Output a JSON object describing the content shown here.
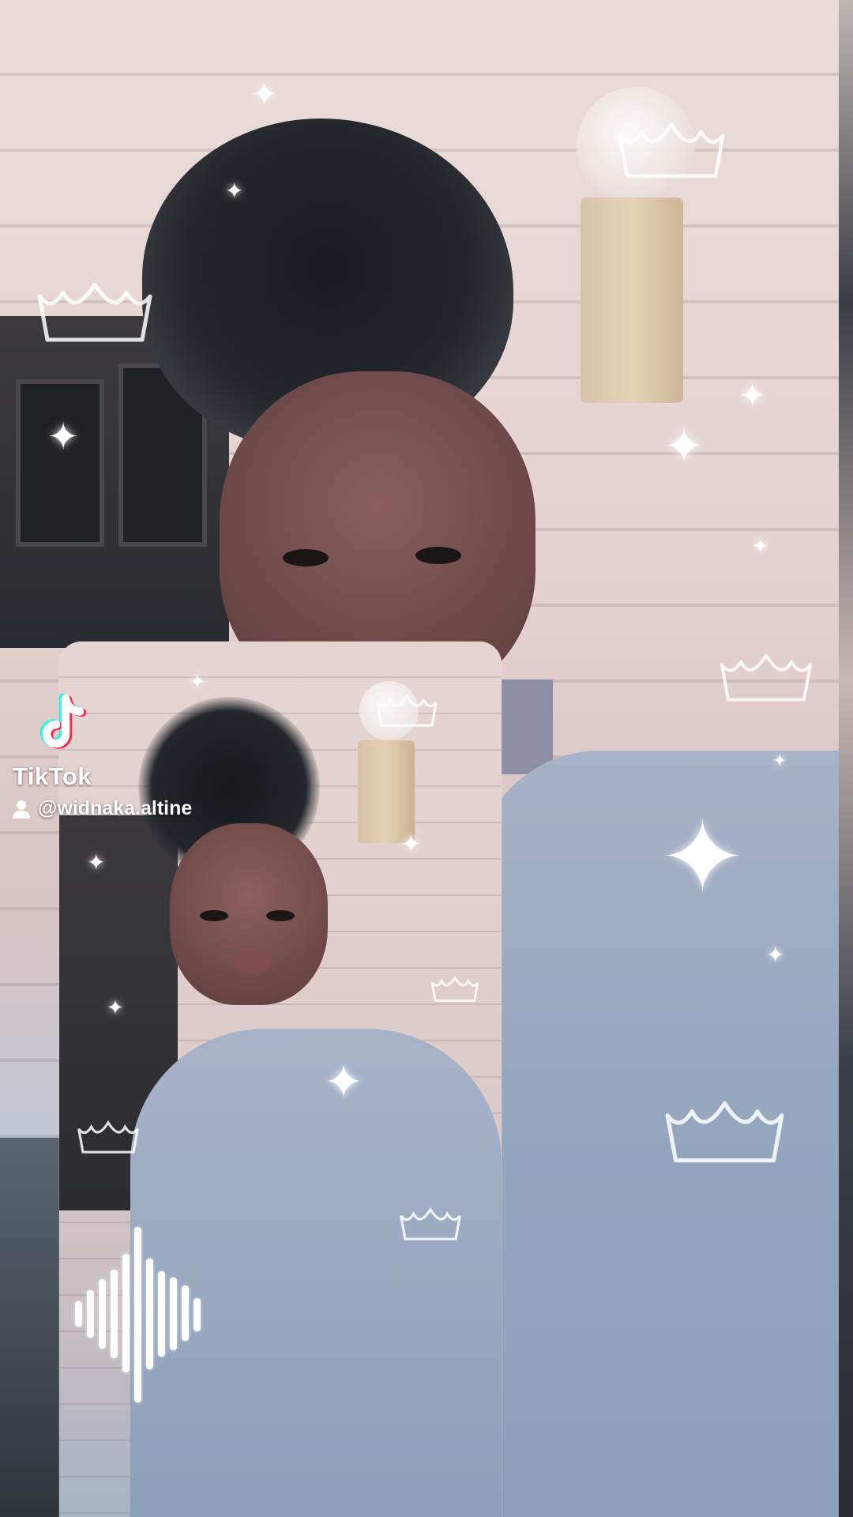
{
  "watermark": {
    "brand": "TikTok",
    "username": "@widnaka.altine",
    "logo_icon": "tiktok-logo-icon",
    "user_icon": "person-icon"
  },
  "colors": {
    "tiktok_cyan": "#25f4ee",
    "tiktok_red": "#fe2c55",
    "text": "#ffffff"
  },
  "overlay_icons": [
    "sparkle-icon",
    "crown-icon",
    "audio-waveform-icon"
  ]
}
